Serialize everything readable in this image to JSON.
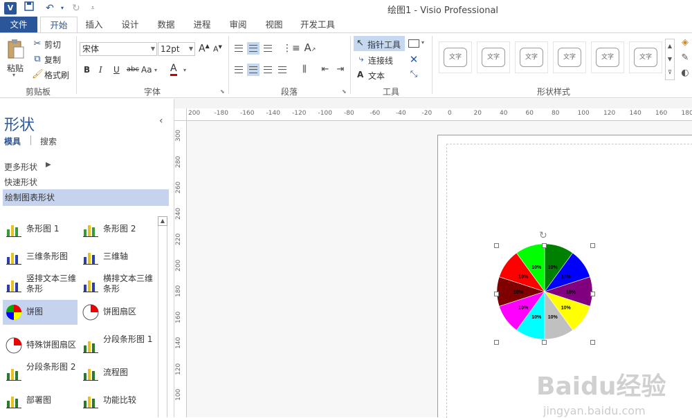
{
  "titlebar": {
    "app_icon_text": "V",
    "title": "绘图1 - Visio Professional"
  },
  "tabs": [
    "文件",
    "开始",
    "插入",
    "设计",
    "数据",
    "进程",
    "审阅",
    "视图",
    "开发工具"
  ],
  "ribbon": {
    "clipboard": {
      "paste": "粘贴",
      "cut": "剪切",
      "copy": "复制",
      "format_painter": "格式刷",
      "group": "剪贴板"
    },
    "font": {
      "family": "宋体",
      "size": "12pt",
      "bold": "B",
      "italic": "I",
      "underline": "U",
      "strike": "abc",
      "case": "Aa",
      "color_letter": "A",
      "group": "字体"
    },
    "paragraph": {
      "group": "段落"
    },
    "tools": {
      "pointer": "指针工具",
      "connector": "连接线",
      "text": "文本",
      "text_icon": "A",
      "group": "工具"
    },
    "shape_styles": {
      "thumb_text": "文字",
      "group": "形状样式",
      "count": 6
    }
  },
  "pane": {
    "title": "形状",
    "tab_stencils": "模具",
    "tab_search": "搜索",
    "more_shapes": "更多形状",
    "quick_shapes": "快速形状",
    "stencil_name": "绘制图表形状",
    "items": [
      {
        "label": "条形图 1",
        "icon": "bar-chart-1-icon"
      },
      {
        "label": "条形图 2",
        "icon": "bar-chart-2-icon"
      },
      {
        "label": "三维条形图",
        "icon": "3d-bar-chart-icon"
      },
      {
        "label": "三维轴",
        "icon": "3d-axis-icon"
      },
      {
        "label": "竖排文本三维条形",
        "icon": "vertical-text-3d-bar-icon"
      },
      {
        "label": "横排文本三维条形",
        "icon": "horizontal-text-3d-bar-icon"
      },
      {
        "label": "饼图",
        "icon": "pie-chart-icon"
      },
      {
        "label": "饼图扇区",
        "icon": "pie-sector-icon"
      },
      {
        "label": "特殊饼图扇区",
        "icon": "special-pie-sector-icon"
      },
      {
        "label": "分段条形图 1",
        "icon": "segmented-bar-1-icon"
      },
      {
        "label": "分段条形图 2",
        "icon": "segmented-bar-2-icon"
      },
      {
        "label": "流程图",
        "icon": "flowchart-icon"
      },
      {
        "label": "部署图",
        "icon": "org-chart-icon"
      },
      {
        "label": "功能比较",
        "icon": "feature-compare-icon"
      }
    ]
  },
  "ruler": {
    "h_labels": [
      "200",
      "-180",
      "-160",
      "-140",
      "-120",
      "-100",
      "-80",
      "-60",
      "-40",
      "-20",
      "0",
      "20",
      "40",
      "60",
      "80",
      "100",
      "120",
      "140",
      "160",
      "180"
    ],
    "v_labels": [
      "300",
      "280",
      "260",
      "240",
      "220",
      "200",
      "180",
      "160",
      "140",
      "120",
      "100"
    ]
  },
  "chart_data": {
    "type": "pie",
    "slice_label": "10%",
    "values": [
      10,
      10,
      10,
      10,
      10,
      10,
      10,
      10,
      10,
      10
    ],
    "colors": [
      "#008000",
      "#0000ff",
      "#800080",
      "#ffff00",
      "#c0c0c0",
      "#00ffff",
      "#ff00ff",
      "#800000",
      "#ff0000",
      "#00ff00"
    ]
  },
  "watermark": {
    "main": "Baidu经验",
    "sub": "jingyan.baidu.com"
  }
}
